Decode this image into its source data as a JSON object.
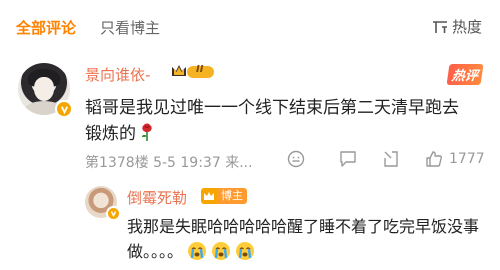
{
  "tabs": {
    "all_comments": "全部评论",
    "owner_only": "只看博主",
    "sort_label": "热度",
    "sort_icon": "sort-icon"
  },
  "comment": {
    "username": "景向谁依-",
    "level": "II",
    "hot_label": "热评",
    "text": "韬哥是我见过唯一一个线下结束后第二天清早跑去锻炼的",
    "emoji": "rose-emoji",
    "meta": "第1378楼 5-5 19:37 来...",
    "likes": "1777"
  },
  "reply": {
    "username": "倒霉死勒",
    "owner_badge": "博主",
    "text": "我那是失眠哈哈哈哈哈醒了睡不着了吃完早饭没事做。。。。",
    "emojis": [
      "crying-emoji",
      "crying-emoji",
      "crying-emoji"
    ]
  },
  "colors": {
    "accent": "#ff8200",
    "username": "#eb7350",
    "meta": "#999999"
  }
}
